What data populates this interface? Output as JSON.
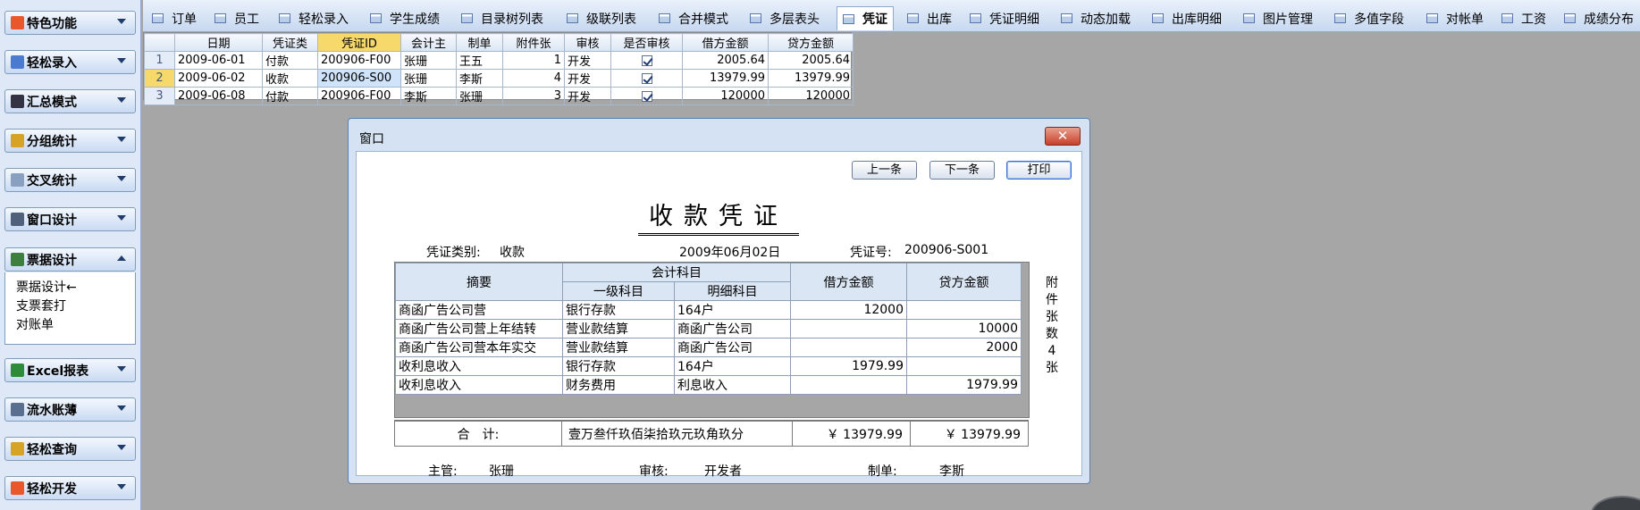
{
  "sidebar": {
    "groups": [
      {
        "label": "特色功能",
        "icon": "feature-icon"
      },
      {
        "label": "轻松录入",
        "icon": "edit-icon"
      },
      {
        "label": "汇总模式",
        "icon": "sigma-icon"
      },
      {
        "label": "分组统计",
        "icon": "group-icon"
      },
      {
        "label": "交叉统计",
        "icon": "cross-table-icon"
      },
      {
        "label": "窗口设计",
        "icon": "window-icon"
      },
      {
        "label": "票据设计",
        "icon": "receipt-icon"
      },
      {
        "label": "Excel报表",
        "icon": "excel-icon"
      },
      {
        "label": "流水账薄",
        "icon": "ledger-icon"
      },
      {
        "label": "轻松查询",
        "icon": "query-icon"
      },
      {
        "label": "轻松开发",
        "icon": "develop-icon"
      }
    ],
    "expanded_items": [
      "票据设计←",
      "支票套打",
      "对账单"
    ]
  },
  "tabs": [
    "订单",
    "员工",
    "轻松录入",
    "学生成绩",
    "目录树列表",
    "级联列表",
    "合并模式",
    "多层表头",
    "凭证",
    "出库",
    "凭证明细",
    "动态加载",
    "出库明细",
    "图片管理",
    "多值字段",
    "对帐单",
    "工资",
    "成绩分布"
  ],
  "active_tab": "凭证",
  "grid": {
    "headers": [
      "日期",
      "凭证类",
      "凭证ID",
      "会计主",
      "制单",
      "附件张",
      "审核",
      "是否审核",
      "借方金额",
      "贷方金额"
    ],
    "rows": [
      {
        "n": "1",
        "date": "2009-06-01",
        "type": "付款",
        "id": "200906-F00",
        "acct": "张珊",
        "maker": "王五",
        "att": "1",
        "audit": "开发",
        "debit": "2005.64",
        "credit": "2005.64"
      },
      {
        "n": "2",
        "date": "2009-06-02",
        "type": "收款",
        "id": "200906-S00",
        "acct": "张珊",
        "maker": "李斯",
        "att": "4",
        "audit": "开发",
        "debit": "13979.99",
        "credit": "13979.99"
      },
      {
        "n": "3",
        "date": "2009-06-08",
        "type": "付款",
        "id": "200906-F00",
        "acct": "李斯",
        "maker": "张珊",
        "att": "3",
        "audit": "开发",
        "debit": "120000",
        "credit": "120000"
      }
    ]
  },
  "dialog": {
    "title": "窗口",
    "close": "✕",
    "buttons": {
      "prev": "上一条",
      "next": "下一条",
      "print": "打印"
    },
    "voucher_title": "收款凭证",
    "type_label": "凭证类别:",
    "type_value": "收款",
    "date": "2009年06月02日",
    "no_label": "凭证号:",
    "no_value": "200906-S001",
    "table": {
      "h_summary": "摘要",
      "h_subject": "会计科目",
      "h_level1": "一级科目",
      "h_detail": "明细科目",
      "h_debit": "借方金额",
      "h_credit": "贷方金额",
      "rows": [
        {
          "summary": "商函广告公司营",
          "level1": "银行存款",
          "detail": "164户",
          "debit": "12000",
          "credit": ""
        },
        {
          "summary": "商函广告公司营上年结转",
          "level1": "营业款结算",
          "detail": "商函广告公司",
          "debit": "",
          "credit": "10000"
        },
        {
          "summary": "商函广告公司营本年实交",
          "level1": "营业款结算",
          "detail": "商函广告公司",
          "debit": "",
          "credit": "2000"
        },
        {
          "summary": "收利息收入",
          "level1": "银行存款",
          "detail": "164户",
          "debit": "1979.99",
          "credit": ""
        },
        {
          "summary": "收利息收入",
          "level1": "财务费用",
          "detail": "利息收入",
          "debit": "",
          "credit": "1979.99"
        }
      ]
    },
    "total_label": "合　计:",
    "total_words": "壹万叁仟玖佰柒拾玖元玖角玖分",
    "total_debit": "￥ 13979.99",
    "total_credit": "￥ 13979.99",
    "attach_chars": [
      "附",
      "件",
      "张",
      "数",
      "4",
      "张"
    ],
    "footer": {
      "manager_label": "主管:",
      "manager": "张珊",
      "audit_label": "审核:",
      "audit": "开发者",
      "maker_label": "制单:",
      "maker": "李斯"
    }
  },
  "colors": {
    "accent": "#f7d96b",
    "tab_bg": "#c7d8f0",
    "close": "#c7412a"
  }
}
